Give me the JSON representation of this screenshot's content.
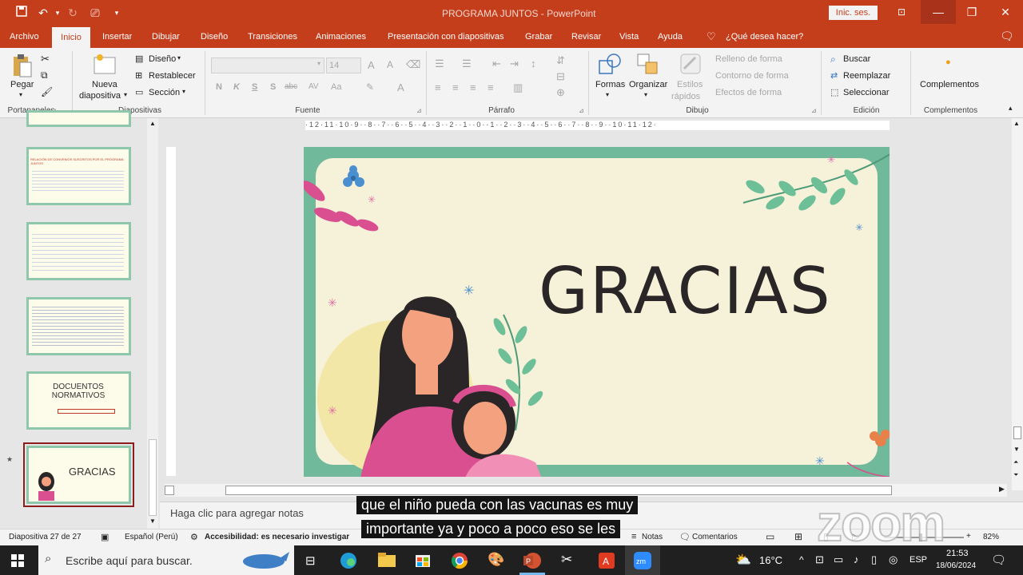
{
  "window": {
    "title": "PROGRAMA JUNTOS  -  PowerPoint",
    "signin_label": "Inic. ses."
  },
  "tabs": [
    "Archivo",
    "Inicio",
    "Insertar",
    "Dibujar",
    "Diseño",
    "Transiciones",
    "Animaciones",
    "Presentación con diapositivas",
    "Grabar",
    "Revisar",
    "Vista",
    "Ayuda"
  ],
  "tell_me": "¿Qué desea hacer?",
  "ribbon": {
    "portapapeles": {
      "paste": "Pegar",
      "group": "Portapapeles"
    },
    "diapositivas": {
      "new_slide_1": "Nueva",
      "new_slide_2": "diapositiva",
      "layout": "Diseño",
      "reset": "Restablecer",
      "section": "Sección",
      "group": "Diapositivas"
    },
    "fuente": {
      "font_size": "14",
      "group": "Fuente",
      "bold": "N",
      "italic": "K",
      "underline": "S",
      "shadow": "S",
      "strike": "abc",
      "spacing": "AV",
      "case": "Aa"
    },
    "parrafo": {
      "group": "Párrafo"
    },
    "dibujo": {
      "shapes": "Formas",
      "arrange": "Organizar",
      "quick_styles_1": "Estilos",
      "quick_styles_2": "rápidos",
      "fill": "Relleno de forma",
      "outline": "Contorno de forma",
      "effects": "Efectos de forma",
      "group": "Dibujo"
    },
    "edicion": {
      "find": "Buscar",
      "replace": "Reemplazar",
      "select": "Seleccionar",
      "group": "Edición"
    },
    "complementos": {
      "addins": "Complementos",
      "group": "Complementos"
    }
  },
  "thumbnails": [
    {
      "text": ""
    },
    {
      "text": "RELACIÓN DE CONVENIOS SUSCRITOS POR EL PROGRAMA JUNTOS"
    },
    {
      "text": ""
    },
    {
      "text": ""
    },
    {
      "text": "DOCUENTOS NORMATIVOS"
    },
    {
      "text": "GRACIAS"
    }
  ],
  "slide": {
    "title": "GRACIAS"
  },
  "notes_placeholder": "Haga clic para agregar notas",
  "subtitles": [
    "que el niño pueda con las vacunas es muy",
    "importante ya y poco a poco eso se les"
  ],
  "status": {
    "slide_count": "Diapositiva 27 de 27",
    "language": "Español (Perú)",
    "accessibility": "Accesibilidad: es necesario investigar",
    "notes": "Notas",
    "comments": "Comentarios",
    "zoom": "82%"
  },
  "taskbar": {
    "search_placeholder": "Escribe aquí para buscar.",
    "weather": "16°C",
    "lang": "ESP",
    "time": "21:53",
    "date": "18/06/2024"
  },
  "watermark": "zoom",
  "colors": {
    "accent": "#c43e1c",
    "slide_border": "#70b99a",
    "slide_bg": "#f6f1d9"
  }
}
